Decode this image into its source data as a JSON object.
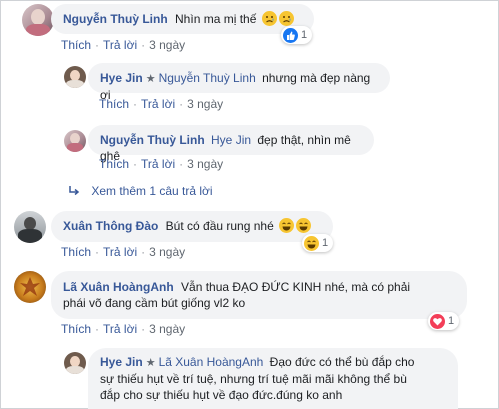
{
  "actions": {
    "like": "Thích",
    "reply": "Trả lời",
    "sep": "·",
    "time_3d": "3 ngày"
  },
  "comments": [
    {
      "author": "Nguyễn Thuỳ Linh",
      "text": "Nhìn ma mị thế",
      "reaction_count": "1"
    },
    {
      "author": "Hye Jin",
      "tag": "Nguyễn Thuỳ Linh",
      "text": "nhưng mà đẹp nàng ơi"
    },
    {
      "author": "Nguyễn Thuỳ Linh",
      "tag": "Hye Jin",
      "text": "đẹp thật, nhìn mê ghê"
    },
    {
      "author": "Xuân Thông Đào",
      "text": "Bút có đầu rung nhé",
      "reaction_count": "1"
    },
    {
      "author": "Lã Xuân HoàngAnh",
      "text_line1": "Vẫn thua ĐẠO ĐỨC KINH nhé, mà có phải",
      "text_line2": "phái võ đang cầm bút giống vl2 ko",
      "reaction_count": "1"
    },
    {
      "author": "Hye Jin",
      "tag": "Lã Xuân HoàngAnh",
      "text_line1": "Đạo đức có thể bù đắp cho",
      "text_line2": "sự thiếu hụt về trí tuệ, nhưng trí tuệ mãi mãi không thể bù",
      "text_line3": "đắp cho sự thiếu hụt về đạo đức.đúng ko anh"
    }
  ],
  "view_more": "Xem thêm 1 câu trả lời",
  "colors": {
    "link": "#385898",
    "bubble": "#f2f3f5",
    "like_blue": "#1877f2",
    "love_red": "#f33e58"
  }
}
